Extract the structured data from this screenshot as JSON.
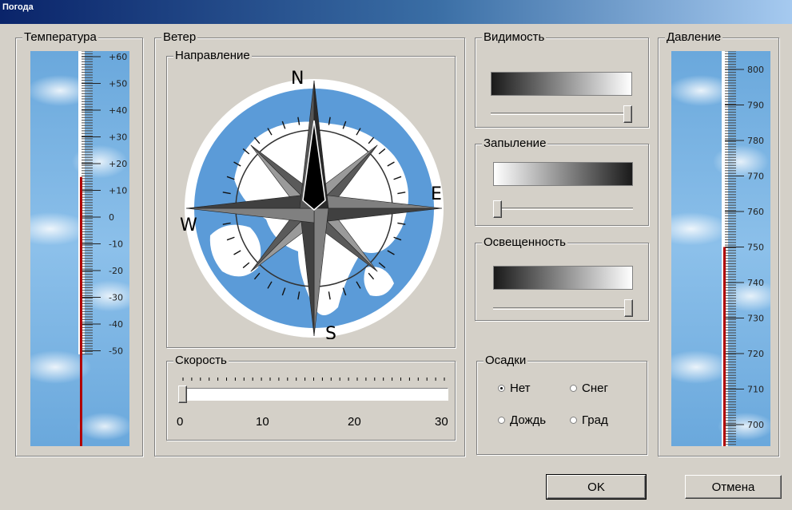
{
  "window": {
    "title": "Погода"
  },
  "temperature": {
    "legend": "Температура",
    "scale_labels": [
      "+60",
      "+50",
      "+40",
      "+30",
      "+20",
      "+10",
      "0",
      "-10",
      "-20",
      "-30",
      "-40",
      "-50"
    ],
    "current_value": 15
  },
  "wind": {
    "legend": "Ветер",
    "direction": {
      "legend": "Направление",
      "cardinals": {
        "north": "N",
        "east": "E",
        "south": "S",
        "west": "W"
      }
    },
    "speed": {
      "legend": "Скорость",
      "tick_labels": [
        "0",
        "10",
        "20",
        "30"
      ],
      "value": 0
    }
  },
  "visibility": {
    "legend": "Видимость",
    "slider_fraction": 1.0
  },
  "dustiness": {
    "legend": "Запыление",
    "slider_fraction": 0.0
  },
  "lighting": {
    "legend": "Освещенность",
    "slider_fraction": 1.0
  },
  "precipitation": {
    "legend": "Осадки",
    "options": [
      {
        "label": "Нет",
        "checked": true
      },
      {
        "label": "Снег",
        "checked": false
      },
      {
        "label": "Дождь",
        "checked": false
      },
      {
        "label": "Град",
        "checked": false
      }
    ]
  },
  "pressure": {
    "legend": "Давление",
    "scale_labels": [
      "800",
      "790",
      "780",
      "770",
      "760",
      "750",
      "740",
      "730",
      "720",
      "710",
      "700"
    ],
    "current_value": 750
  },
  "buttons": {
    "ok": "OK",
    "cancel": "Отмена"
  },
  "colors": {
    "mercury": "#b00000",
    "map_water": "#5b9bd8",
    "title_bar": "#0a246a"
  }
}
